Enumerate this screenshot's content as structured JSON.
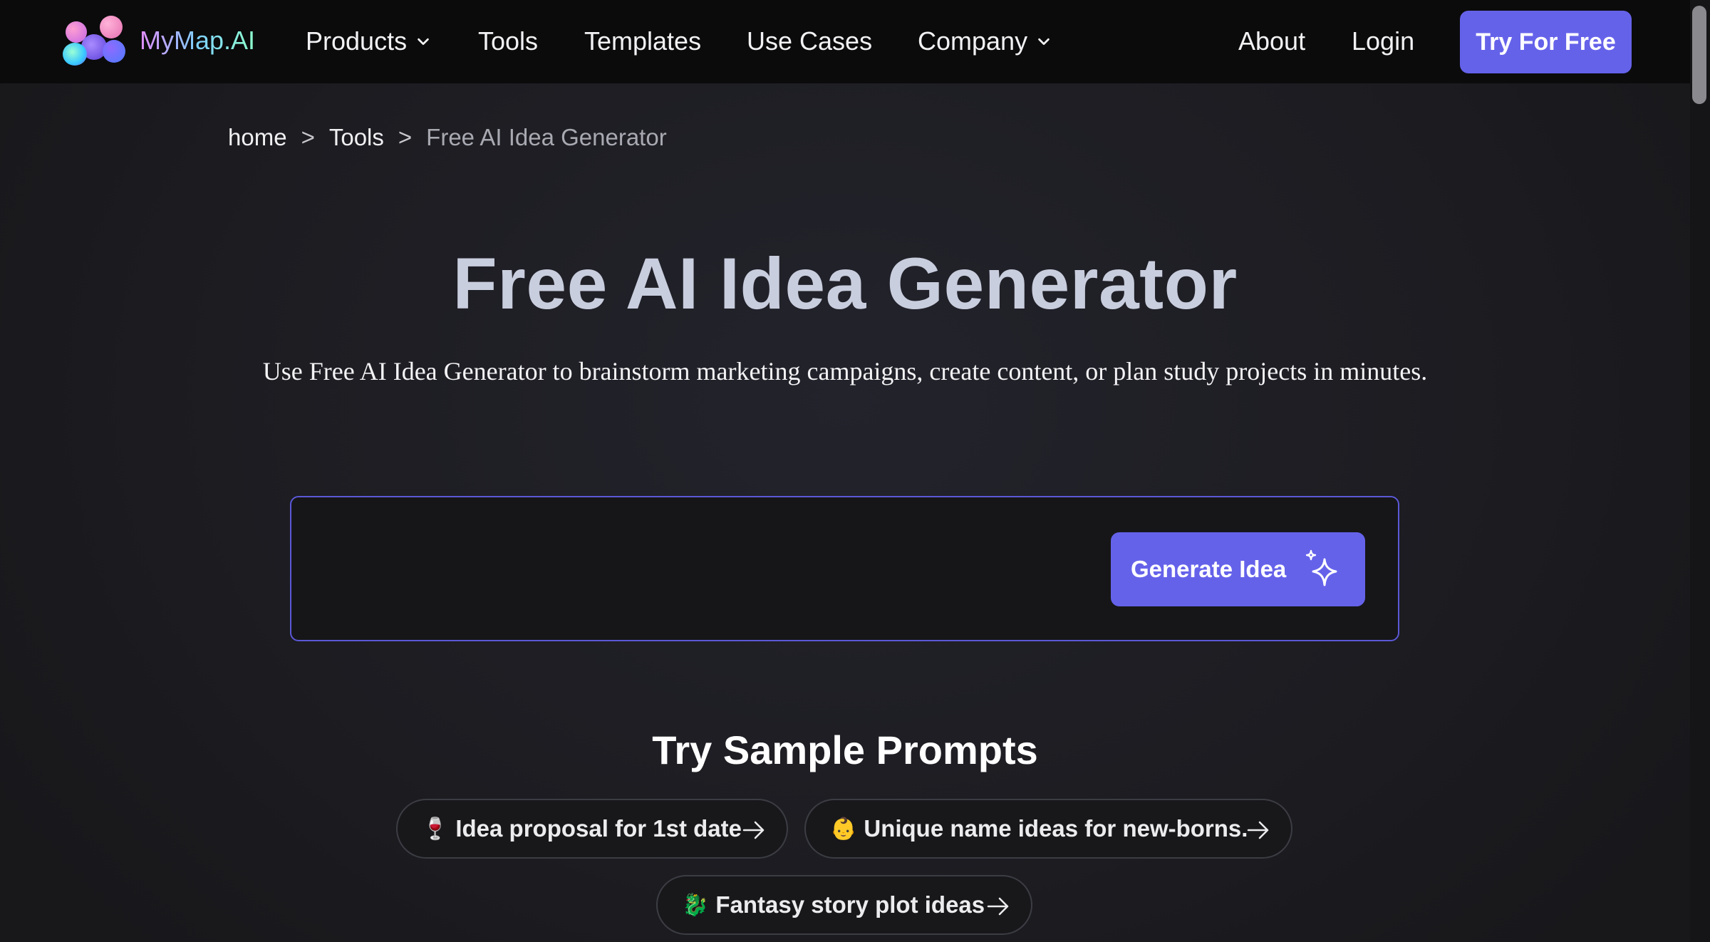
{
  "nav": {
    "brand": "MyMap.AI",
    "products": "Products",
    "tools": "Tools",
    "templates": "Templates",
    "use_cases": "Use Cases",
    "company": "Company",
    "about": "About",
    "login": "Login",
    "try_free": "Try For Free"
  },
  "breadcrumb": {
    "home": "home",
    "sep": ">",
    "tools": "Tools",
    "current": "Free AI Idea Generator"
  },
  "hero": {
    "title": "Free AI Idea Generator",
    "subtitle": "Use Free AI Idea Generator to brainstorm marketing campaigns, create content, or plan study projects in minutes."
  },
  "input": {
    "value": "",
    "button_label": "Generate Idea"
  },
  "samples": {
    "title": "Try Sample Prompts",
    "chips": [
      {
        "emoji": "🍷",
        "label": "Idea proposal for 1st date"
      },
      {
        "emoji": "👶",
        "label": "Unique name ideas for new-borns."
      },
      {
        "emoji": "🐉",
        "label": "Fantasy story plot ideas"
      }
    ]
  },
  "colors": {
    "accent": "#6562ea",
    "nav_bg": "#0b0b0c",
    "page_bg": "#1b1b1f",
    "title": "#c9cede"
  }
}
